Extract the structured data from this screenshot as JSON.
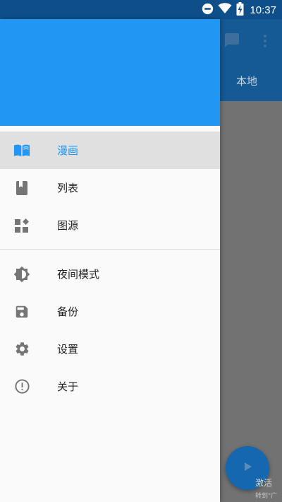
{
  "status_bar": {
    "time": "10:37",
    "icons": [
      "do-not-disturb-icon",
      "wifi-icon",
      "battery-charging-icon"
    ]
  },
  "background_app": {
    "tab_label": "本地",
    "icons": [
      "chat-icon",
      "more-vert-icon",
      "play-icon"
    ]
  },
  "watermark": {
    "line1": "激活",
    "line2": "转到\"广"
  },
  "drawer": {
    "header_color": "#2196F3",
    "items": [
      {
        "label": "漫画",
        "icon": "book-open-icon",
        "selected": true
      },
      {
        "label": "列表",
        "icon": "bookmark-book-icon",
        "selected": false
      },
      {
        "label": "图源",
        "icon": "widgets-icon",
        "selected": false
      }
    ],
    "items2": [
      {
        "label": "夜间模式",
        "icon": "brightness-icon",
        "selected": false
      },
      {
        "label": "备份",
        "icon": "save-icon",
        "selected": false
      },
      {
        "label": "设置",
        "icon": "gear-icon",
        "selected": false
      },
      {
        "label": "关于",
        "icon": "info-icon",
        "selected": false
      }
    ]
  },
  "colors": {
    "primary": "#2196F3",
    "status_bar": "#0E4F8A",
    "icon_gray": "#757575"
  }
}
